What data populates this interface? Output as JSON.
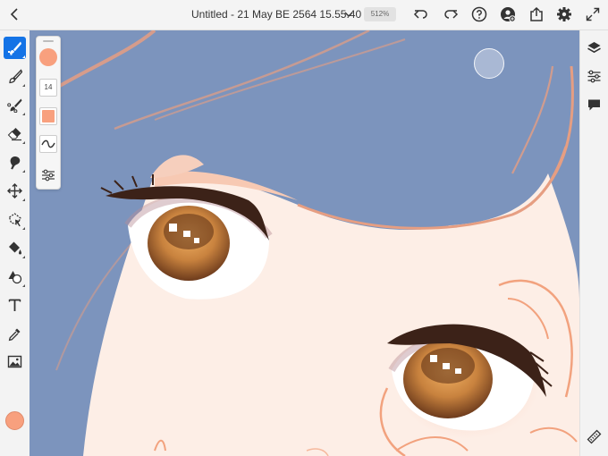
{
  "header": {
    "document_title": "Untitled - 21 May BE 2564 15.55.40 *",
    "zoom_level": "512%",
    "icons": [
      "back-icon",
      "chevron-down-icon",
      "undo-icon",
      "redo-icon",
      "help-icon",
      "invite-user-icon",
      "share-icon",
      "settings-gear-icon",
      "fullscreen-icon"
    ]
  },
  "left_toolbar": {
    "tools": [
      "pixel-brush",
      "live-brush",
      "vector-brush",
      "eraser",
      "smudge",
      "transform",
      "lasso-selection",
      "fill",
      "shapes",
      "text",
      "eyedropper",
      "place-image"
    ],
    "active_tool": "pixel-brush",
    "current_color": "#f8a07e"
  },
  "brush_panel": {
    "size_value": "14",
    "brush_color": "#f8a07e"
  },
  "right_toolbar": {
    "icons": [
      "layers-icon",
      "properties-icon",
      "comments-icon",
      "touch-shortcut-icon"
    ]
  },
  "colors": {
    "accent": "#1473e6",
    "canvas_background": "#7c94bd",
    "skin": "#fdeee6",
    "line_orange": "#f2a27e"
  }
}
